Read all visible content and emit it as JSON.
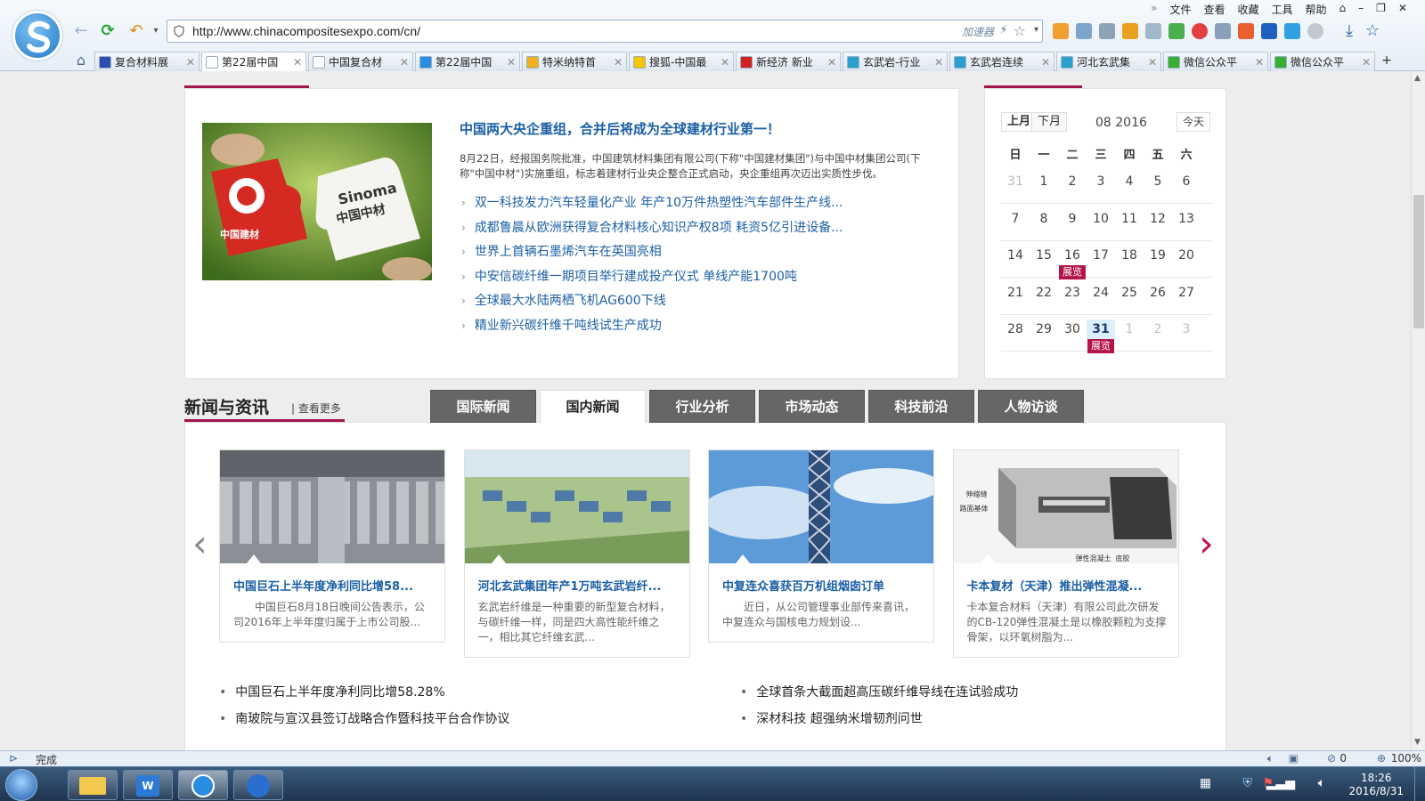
{
  "browser": {
    "url": "http://www.chinacompositesexpo.com/cn/",
    "accelerator_label": "加速器",
    "menu": [
      "文件",
      "查看",
      "收藏",
      "工具",
      "帮助"
    ],
    "tabs": [
      {
        "label": "复合材料展",
        "active": false,
        "color": "#2a4fb0"
      },
      {
        "label": "第22届中国",
        "active": true,
        "color": "#ffffff"
      },
      {
        "label": "中国复合材",
        "active": false,
        "color": "#ffffff"
      },
      {
        "label": "第22届中国",
        "active": false,
        "color": "#2a8de0"
      },
      {
        "label": "特米纳特首",
        "active": false,
        "color": "#f0b020"
      },
      {
        "label": "搜狐-中国最",
        "active": false,
        "color": "#f5c400"
      },
      {
        "label": "新经济 新业",
        "active": false,
        "color": "#d02020"
      },
      {
        "label": "玄武岩-行业",
        "active": false,
        "color": "#2aa0d0"
      },
      {
        "label": "玄武岩连续",
        "active": false,
        "color": "#2aa0d0"
      },
      {
        "label": "河北玄武集",
        "active": false,
        "color": "#2aa0d0"
      },
      {
        "label": "微信公众平",
        "active": false,
        "color": "#36b030"
      },
      {
        "label": "微信公众平",
        "active": false,
        "color": "#36b030"
      }
    ]
  },
  "focus": {
    "headline": "中国两大央企重组，合并后将成为全球建材行业第一！",
    "summary": "8月22日，经报国务院批准，中国建筑材料集团有限公司(下称\"中国建材集团\")与中国中材集团公司(下称\"中国中材\")实施重组，标志着建材行业央企整合正式启动，央企重组再次迈出实质性步伐。",
    "image_left_text": "中国建材",
    "image_right_brand": "Sinoma",
    "image_right_text": "中国中材",
    "links": [
      "双一科技发力汽车轻量化产业 年产10万件热塑性汽车部件生产线...",
      "成都鲁晨从欧洲获得复合材料核心知识产权8项 耗资5亿引进设备...",
      "世界上首辆石墨烯汽车在英国亮相",
      "中安信碳纤维一期项目举行建成投产仪式 单线产能1700吨",
      "全球最大水陆两栖飞机AG600下线",
      "精业新兴碳纤维千吨线试生产成功"
    ]
  },
  "calendar": {
    "prev_label": "上月",
    "next_label": "下月",
    "month_label": "08 2016",
    "today_label": "今天",
    "weekdays": [
      "日",
      "一",
      "二",
      "三",
      "四",
      "五",
      "六"
    ],
    "weeks": [
      [
        "31",
        "1",
        "2",
        "3",
        "4",
        "5",
        "6"
      ],
      [
        "7",
        "8",
        "9",
        "10",
        "11",
        "12",
        "13"
      ],
      [
        "14",
        "15",
        "16",
        "17",
        "18",
        "19",
        "20"
      ],
      [
        "21",
        "22",
        "23",
        "24",
        "25",
        "26",
        "27"
      ],
      [
        "28",
        "29",
        "30",
        "31",
        "1",
        "2",
        "3"
      ]
    ],
    "expo_label": "展览"
  },
  "news": {
    "title": "新闻与资讯",
    "more": "| 查看更多",
    "tabs": [
      "国际新闻",
      "国内新闻",
      "行业分析",
      "市场动态",
      "科技前沿",
      "人物访谈"
    ],
    "active_tab": "国内新闻",
    "cards": [
      {
        "title": "中国巨石上半年度净利同比增58...",
        "desc": "　　中国巨石8月18日晚间公告表示，公司2016年上半年度归属于上市公司股..."
      },
      {
        "title": "河北玄武集团年产1万吨玄武岩纤...",
        "desc": "玄武岩纤维是一种重要的新型复合材料，与碳纤维一样，同是四大高性能纤维之一，相比其它纤维玄武..."
      },
      {
        "title": "中复连众喜获百万机组烟囱订单",
        "desc": "　　近日，从公司管理事业部传来喜讯，中复连众与国核电力规划设..."
      },
      {
        "title": "卡本复材（天津）推出弹性混凝...",
        "desc": "卡本复合材料（天津）有限公司此次研发的CB-120弹性混凝土是以橡胶颗粒为支撑骨架，以环氧树脂为...",
        "labels": [
          "伸缩缝",
          "路面基体",
          "弹性混凝土",
          "底胶"
        ]
      }
    ],
    "list_left": [
      "中国巨石上半年度净利同比增58.28%",
      "南玻院与宣汉县签订战略合作暨科技平台合作协议"
    ],
    "list_right": [
      "全球首条大截面超高压碳纤维导线在连试验成功",
      "深材科技 超强纳米增韧剂问世"
    ]
  },
  "status": {
    "left": "完成",
    "count": "0",
    "zoom": "100%"
  },
  "taskbar": {
    "time": "18:26",
    "date": "2016/8/31"
  }
}
